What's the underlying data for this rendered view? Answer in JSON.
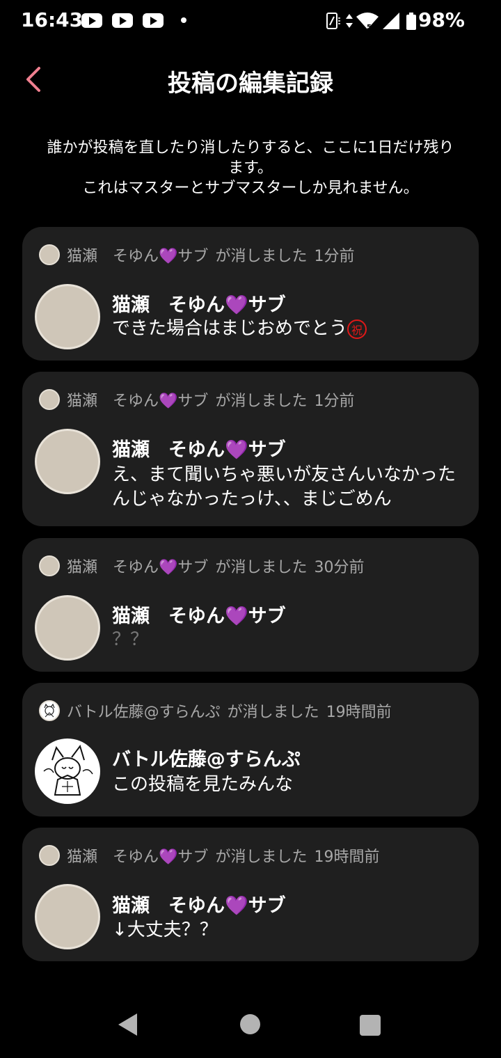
{
  "status": {
    "time": "16:43",
    "battery": "98%",
    "notification_icons": [
      "youtube-icon",
      "youtube-icon",
      "youtube-icon"
    ],
    "system_icons": [
      "nfc-icon",
      "data-arrows-icon",
      "wifi-icon",
      "signal-icon",
      "battery-icon"
    ]
  },
  "header": {
    "title": "投稿の編集記録"
  },
  "notice": {
    "line1": "誰かが投稿を直したり消したりすると、ここに1日だけ残り",
    "line2": "ます。",
    "line3": "これはマスターとサブマスターしか見れません。"
  },
  "records": [
    {
      "head_name": "猫瀬　そゆん",
      "head_heart": "💜",
      "head_name_tail": "サブ",
      "action": "が消しました",
      "time": "1分前",
      "name": "猫瀬　そゆん",
      "heart": "💜",
      "name_tail": "サブ",
      "body": "できた場合はまじおめでとう",
      "body_emoji": "祝"
    },
    {
      "head_name": "猫瀬　そゆん",
      "head_heart": "💜",
      "head_name_tail": "サブ",
      "action": "が消しました",
      "time": "1分前",
      "name": "猫瀬　そゆん",
      "heart": "💜",
      "name_tail": "サブ",
      "body": "え、まて聞いちゃ悪いが友さんいなかったんじゃなかったっけ、、まじごめん"
    },
    {
      "head_name": "猫瀬　そゆん",
      "head_heart": "💜",
      "head_name_tail": "サブ",
      "action": "が消しました",
      "time": "30分前",
      "name": "猫瀬　そゆん",
      "heart": "💜",
      "name_tail": "サブ",
      "body": "？？"
    },
    {
      "head_name": "バトル佐藤@すらんぷ",
      "action": "が消しました",
      "time": "19時間前",
      "name": "バトル佐藤@すらんぷ",
      "body": "この投稿を見たみんな"
    },
    {
      "head_name": "猫瀬　そゆん",
      "head_heart": "💜",
      "head_name_tail": "サブ",
      "action": "が消しました",
      "time": "19時間前",
      "name": "猫瀬　そゆん",
      "heart": "💜",
      "name_tail": "サブ",
      "body": "↓大丈夫？？"
    }
  ],
  "colors": {
    "background": "#000000",
    "card": "#1f1f1f",
    "accent_back": "#f08090",
    "heart": "#8e1fa8",
    "meta_text": "#a8a8a8"
  }
}
